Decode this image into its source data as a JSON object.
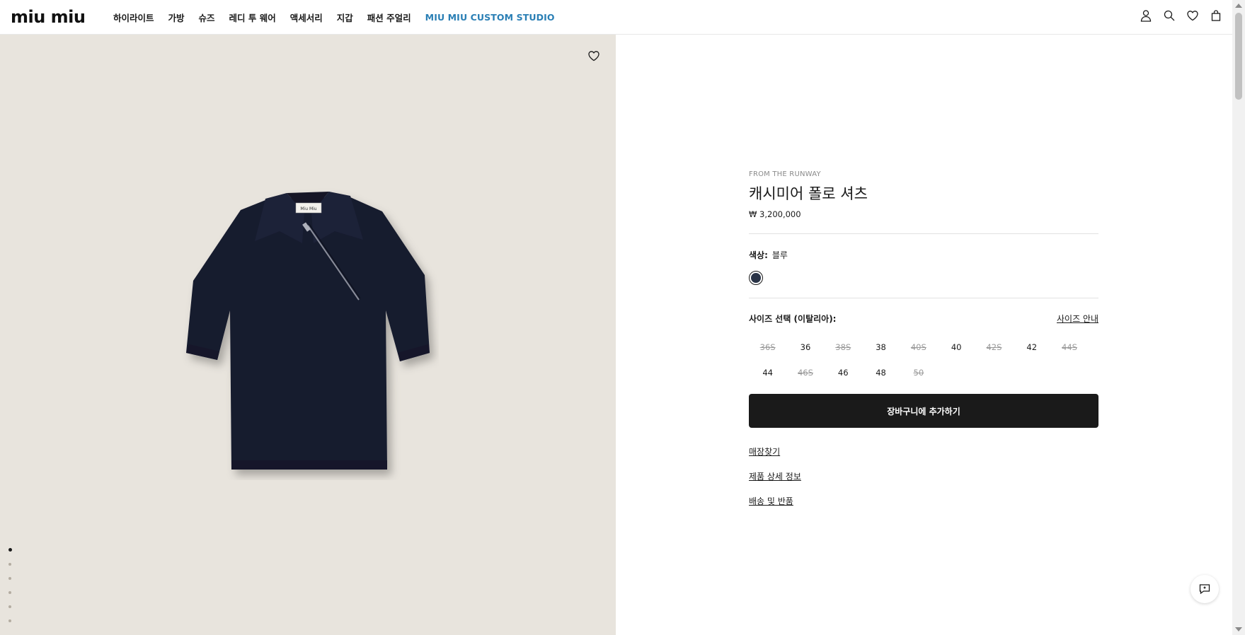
{
  "brand": {
    "logo_text": "miu miu"
  },
  "nav": {
    "items": [
      "하이라이트",
      "가방",
      "슈즈",
      "레디 투 웨어",
      "액세서리",
      "지갑",
      "패션 주얼리"
    ],
    "accent_item": "MIU MIU CUSTOM STUDIO",
    "accent_color": "#2a7fb5"
  },
  "header_icons": [
    "user-icon",
    "search-icon",
    "heart-icon",
    "bag-icon"
  ],
  "gallery": {
    "background": "#e8e4dd",
    "dot_count": 6,
    "active_dot": 0
  },
  "product": {
    "eyebrow": "FROM THE RUNWAY",
    "title": "캐시미어 폴로 셔츠",
    "price": "₩ 3,200,000",
    "color_label": "색상:",
    "color_value": "블루",
    "swatch_color": "#2a3447",
    "size_label": "사이즈 선택 (이탈리아):",
    "size_guide": "사이즈 안내",
    "sizes": [
      {
        "label": "36S",
        "available": false
      },
      {
        "label": "36",
        "available": true
      },
      {
        "label": "38S",
        "available": false
      },
      {
        "label": "38",
        "available": true
      },
      {
        "label": "40S",
        "available": false
      },
      {
        "label": "40",
        "available": true
      },
      {
        "label": "42S",
        "available": false
      },
      {
        "label": "42",
        "available": true
      },
      {
        "label": "44S",
        "available": false
      },
      {
        "label": "44",
        "available": true
      },
      {
        "label": "46S",
        "available": false
      },
      {
        "label": "46",
        "available": true
      },
      {
        "label": "48",
        "available": true
      },
      {
        "label": "50",
        "available": false
      }
    ],
    "add_to_cart": "장바구니에 추가하기",
    "links": [
      "매장찾기",
      "제품 상세 정보",
      "배송 및 반품"
    ]
  }
}
